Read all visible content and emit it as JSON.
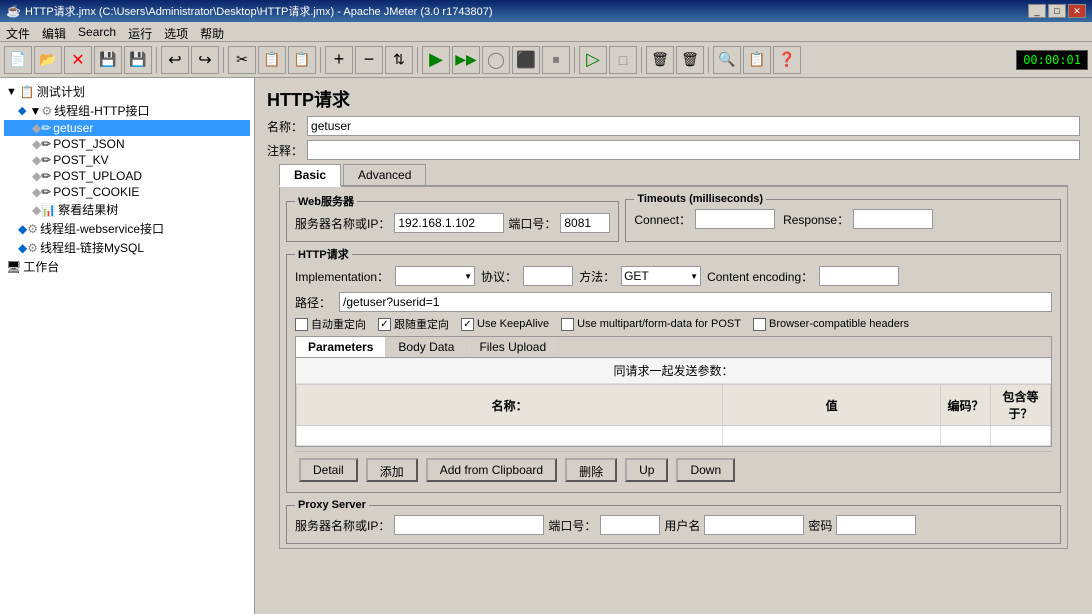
{
  "titleBar": {
    "title": "HTTP请求.jmx (C:\\Users\\Administrator\\Desktop\\HTTP请求.jmx) - Apache JMeter (3.0 r1743807)",
    "icon": "jmeter-icon"
  },
  "menuBar": {
    "items": [
      "文件",
      "编辑",
      "Search",
      "运行",
      "选项",
      "帮助"
    ]
  },
  "toolbar": {
    "buttons": [
      {
        "name": "new",
        "icon": "📄"
      },
      {
        "name": "open",
        "icon": "📂"
      },
      {
        "name": "close",
        "icon": "✕"
      },
      {
        "name": "save",
        "icon": "💾"
      },
      {
        "name": "save-as",
        "icon": "💾"
      },
      {
        "name": "cut",
        "icon": "✂"
      },
      {
        "name": "copy",
        "icon": "📋"
      },
      {
        "name": "paste",
        "icon": "📋"
      },
      {
        "name": "expand",
        "icon": "➕"
      },
      {
        "name": "collapse",
        "icon": "➖"
      },
      {
        "name": "toggle",
        "icon": "⇅"
      },
      {
        "name": "start",
        "icon": "▶"
      },
      {
        "name": "start-no-pause",
        "icon": "▶▶"
      },
      {
        "name": "validate",
        "icon": "◯"
      },
      {
        "name": "stop",
        "icon": "⏹"
      },
      {
        "name": "shutdown",
        "icon": "⏻"
      },
      {
        "name": "remote-start",
        "icon": "▷"
      },
      {
        "name": "remote-stop",
        "icon": "□"
      },
      {
        "name": "clear",
        "icon": "🗑"
      },
      {
        "name": "clear-all",
        "icon": "🗑"
      },
      {
        "name": "search",
        "icon": "🔍"
      },
      {
        "name": "log",
        "icon": "📋"
      },
      {
        "name": "help",
        "icon": "?"
      }
    ],
    "timer": "00:00:01"
  },
  "tree": {
    "items": [
      {
        "id": "test-plan",
        "label": "测试计划",
        "level": 0,
        "icon": "📋",
        "expanded": true
      },
      {
        "id": "thread-group",
        "label": "线程组-HTTP接口",
        "level": 1,
        "icon": "⚙",
        "expanded": true
      },
      {
        "id": "getuser",
        "label": "getuser",
        "level": 2,
        "icon": "✏",
        "selected": true
      },
      {
        "id": "post-json",
        "label": "POST_JSON",
        "level": 2,
        "icon": "✏"
      },
      {
        "id": "post-kv",
        "label": "POST_KV",
        "level": 2,
        "icon": "✏"
      },
      {
        "id": "post-upload",
        "label": "POST_UPLOAD",
        "level": 2,
        "icon": "✏"
      },
      {
        "id": "post-cookie",
        "label": "POST_COOKIE",
        "level": 2,
        "icon": "✏"
      },
      {
        "id": "view-results",
        "label": "察看结果树",
        "level": 2,
        "icon": "📊"
      },
      {
        "id": "webservice-group",
        "label": "线程组-webservice接口",
        "level": 1,
        "icon": "⚙"
      },
      {
        "id": "mysql-group",
        "label": "线程组-链接MySQL",
        "level": 1,
        "icon": "⚙"
      },
      {
        "id": "workbench",
        "label": "工作台",
        "level": 0,
        "icon": "🖥"
      }
    ]
  },
  "rightPanel": {
    "title": "HTTP请求",
    "nameLabel": "名称：",
    "nameValue": "getuser",
    "commentLabel": "注释：",
    "commentValue": "",
    "tabs": [
      {
        "id": "basic",
        "label": "Basic",
        "active": true
      },
      {
        "id": "advanced",
        "label": "Advanced",
        "active": false
      }
    ],
    "webServer": {
      "groupLabel": "Web服务器",
      "serverLabel": "服务器名称或IP：",
      "serverValue": "192.168.1.102",
      "portLabel": "端口号：",
      "portValue": "8081"
    },
    "timeouts": {
      "groupLabel": "Timeouts (milliseconds)",
      "connectLabel": "Connect：",
      "connectValue": "",
      "responseLabel": "Response：",
      "responseValue": ""
    },
    "httpRequest": {
      "groupLabel": "HTTP请求",
      "implementationLabel": "Implementation：",
      "implementationValue": "",
      "protocolLabel": "协议：",
      "protocolValue": "",
      "methodLabel": "方法：",
      "methodValue": "GET",
      "encodingLabel": "Content encoding：",
      "encodingValue": "",
      "pathLabel": "路径：",
      "pathValue": "/getuser?userid=1",
      "checkboxes": [
        {
          "id": "auto-redirect",
          "label": "自动重定向",
          "checked": false
        },
        {
          "id": "follow-redirect",
          "label": "跟随重定向",
          "checked": true
        },
        {
          "id": "keepalive",
          "label": "Use KeepAlive",
          "checked": true
        },
        {
          "id": "multipart",
          "label": "Use multipart/form-data for POST",
          "checked": false
        },
        {
          "id": "browser-headers",
          "label": "Browser-compatible headers",
          "checked": false
        }
      ]
    },
    "innerTabs": [
      {
        "id": "parameters",
        "label": "Parameters",
        "active": true
      },
      {
        "id": "body-data",
        "label": "Body Data",
        "active": false
      },
      {
        "id": "files-upload",
        "label": "Files Upload",
        "active": false
      }
    ],
    "paramsHeader": "同请求一起发送参数：",
    "tableHeaders": [
      "名称：",
      "值",
      "编码？",
      "包含等于？"
    ],
    "actionButtons": [
      {
        "id": "detail",
        "label": "Detail"
      },
      {
        "id": "add",
        "label": "添加"
      },
      {
        "id": "add-clipboard",
        "label": "Add from Clipboard"
      },
      {
        "id": "delete",
        "label": "删除"
      },
      {
        "id": "up",
        "label": "Up"
      },
      {
        "id": "down",
        "label": "Down"
      }
    ],
    "proxyServer": {
      "groupLabel": "Proxy Server",
      "serverLabel": "服务器名称或IP：",
      "serverValue": "",
      "portLabel": "端口号：",
      "portValue": "",
      "usernameLabel": "用户名",
      "usernameValue": "",
      "passwordLabel": "密码",
      "passwordValue": ""
    }
  }
}
